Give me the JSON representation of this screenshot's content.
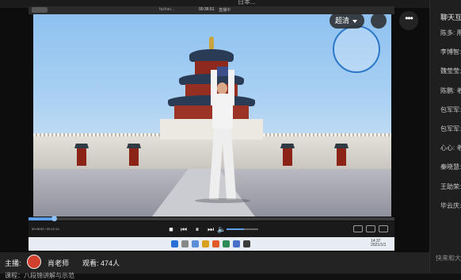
{
  "window": {
    "title": "日本..."
  },
  "inner_bar": {
    "left_label": "fazhan...",
    "time": "00:36:51",
    "status": "直播中"
  },
  "video": {
    "overlay_logo_text": "",
    "quality": {
      "label": "超清"
    },
    "share_icon": "share-icon",
    "more_label": "•••"
  },
  "player": {
    "elapsed_time": "00:08:52 / 00:12:13",
    "progress": 0.07,
    "volume": 0.55
  },
  "chat": {
    "title": "聊天互",
    "names": [
      "陈多: 用",
      "李博智:",
      "魏莹莹:",
      "陈鹏: 老",
      "包军军:",
      "包军军:",
      "心心: 老",
      "秦晓慧:",
      "王助荣:",
      "毕云庆:"
    ],
    "input_hint": "快来和大"
  },
  "footer": {
    "host_label": "主播:",
    "host_name": "肖老师",
    "views_label": "观看: 474人",
    "sub_text": "课程：八段锦讲解与示范"
  },
  "taskbar": {
    "time": "14:37",
    "date": "2021/1/1"
  }
}
